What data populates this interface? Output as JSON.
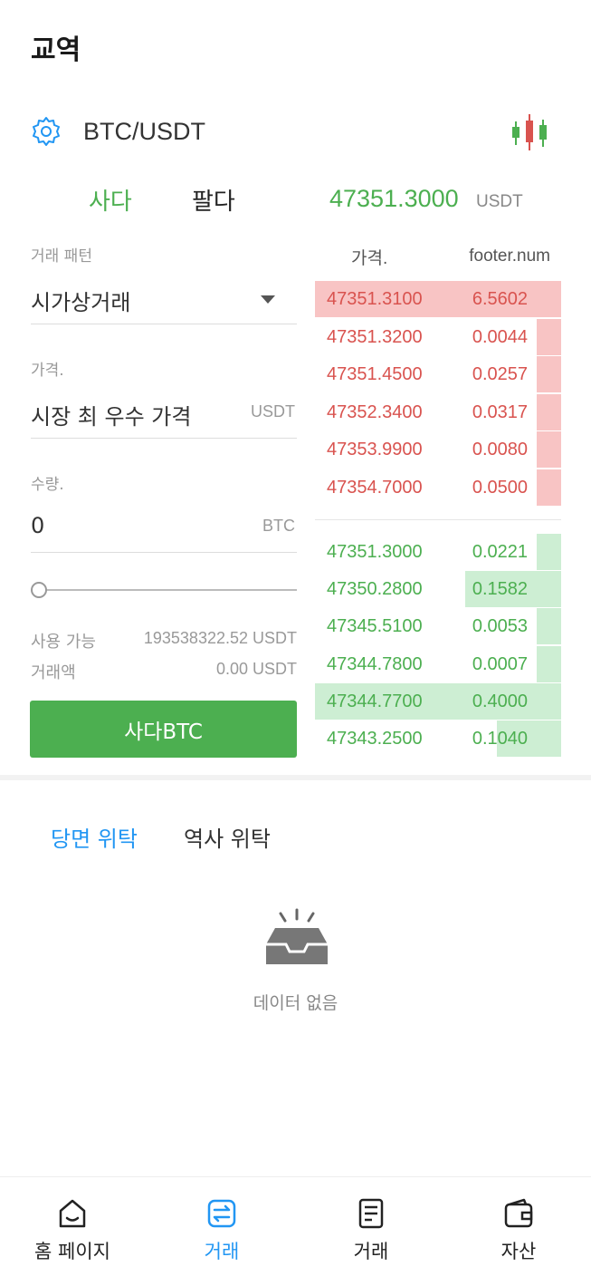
{
  "header": {
    "title": "교역"
  },
  "pair": {
    "name": "BTC/USDT",
    "settings_icon": "gear-icon",
    "chart_icon": "candlestick-icon"
  },
  "side_tabs": {
    "buy": "사다",
    "sell": "팔다",
    "active": "buy"
  },
  "ticker": {
    "last_price": "47351.3000",
    "unit": "USDT"
  },
  "form": {
    "order_type_label": "거래 패턴",
    "order_type_value": "시가상거래",
    "price_label": "가격.",
    "price_value": "시장 최 우수 가격",
    "price_unit": "USDT",
    "amount_label": "수량.",
    "amount_value": "0",
    "amount_unit": "BTC",
    "slider_value": 0,
    "available_label": "사용 가능",
    "available_value": "193538322.52 USDT",
    "turnover_label": "거래액",
    "turnover_value": "0.00 USDT",
    "submit_label": "사다BTC"
  },
  "orderbook": {
    "price_header": "가격.",
    "num_header": "footer.num",
    "asks": [
      {
        "price": "47351.3100",
        "qty": "6.5602",
        "depth": 1.0
      },
      {
        "price": "47351.3200",
        "qty": "0.0044",
        "depth": 0.1
      },
      {
        "price": "47351.4500",
        "qty": "0.0257",
        "depth": 0.1
      },
      {
        "price": "47352.3400",
        "qty": "0.0317",
        "depth": 0.1
      },
      {
        "price": "47353.9900",
        "qty": "0.0080",
        "depth": 0.1
      },
      {
        "price": "47354.7000",
        "qty": "0.0500",
        "depth": 0.1
      }
    ],
    "bids": [
      {
        "price": "47351.3000",
        "qty": "0.0221",
        "depth": 0.1
      },
      {
        "price": "47350.2800",
        "qty": "0.1582",
        "depth": 0.39
      },
      {
        "price": "47345.5100",
        "qty": "0.0053",
        "depth": 0.1
      },
      {
        "price": "47344.7800",
        "qty": "0.0007",
        "depth": 0.1
      },
      {
        "price": "47344.7700",
        "qty": "0.4000",
        "depth": 1.0
      },
      {
        "price": "47343.2500",
        "qty": "0.1040",
        "depth": 0.26
      }
    ],
    "ask_color": "#d9534f",
    "bid_color": "#4caf50"
  },
  "orders": {
    "tab_current": "당면 위탁",
    "tab_history": "역사 위탁",
    "empty_icon": "empty-tray-icon",
    "empty_text": "데이터 없음"
  },
  "nav": {
    "items": [
      {
        "label": "홈 페이지",
        "icon": "home-icon"
      },
      {
        "label": "거래",
        "icon": "exchange-icon"
      },
      {
        "label": "거래",
        "icon": "order-list-icon"
      },
      {
        "label": "자산",
        "icon": "wallet-icon"
      }
    ],
    "active_index": 1,
    "active_color": "#2196f3"
  },
  "colors": {
    "accent_green": "#4caf50",
    "accent_red": "#d9534f",
    "accent_blue": "#2196f3"
  }
}
